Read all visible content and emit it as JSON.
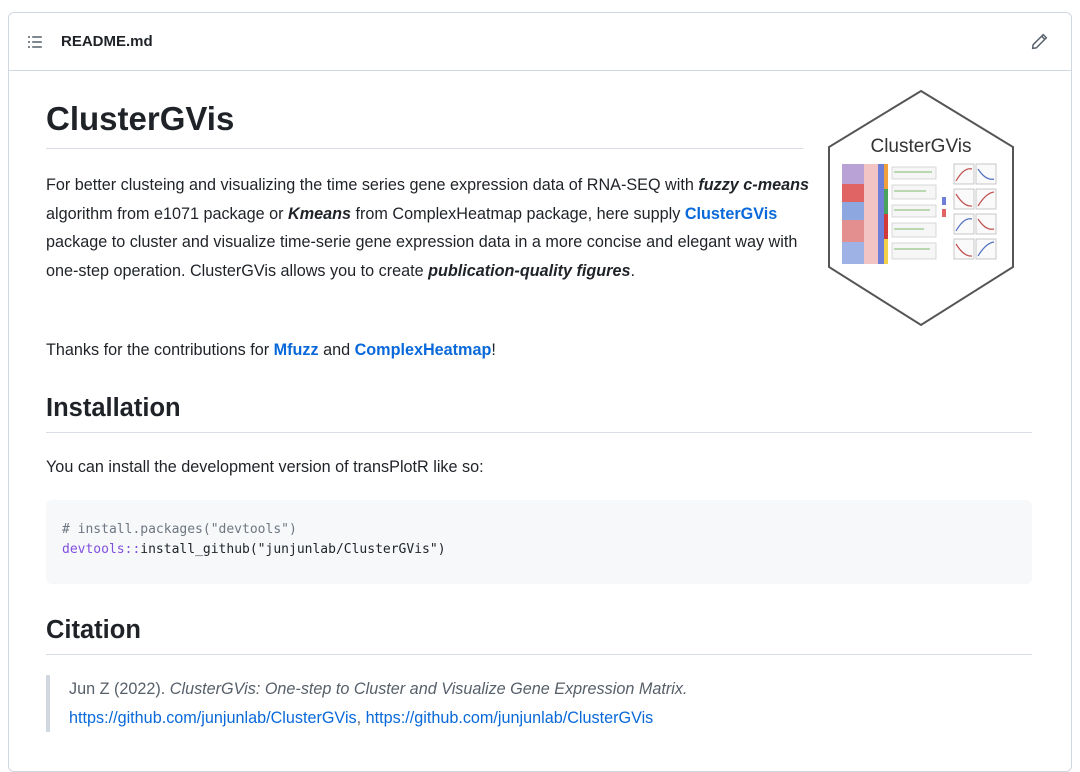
{
  "header": {
    "file_name": "README.md",
    "list_icon": "list-unordered-icon",
    "edit_icon": "pencil-icon"
  },
  "title": "ClusterGVis",
  "logo": {
    "text": "ClusterGVis"
  },
  "intro": {
    "t1": "For better clusteing and visualizing the time series gene expression data of RNA-SEQ with ",
    "e1": "fuzzy c-means",
    "t2": " algorithm from e1071 package or ",
    "e2": "Kmeans",
    "t3": " from ComplexHeatmap package, here supply ",
    "link": "ClusterGVis",
    "t4": " package to cluster and visualize time-serie gene expression data in a more concise and elegant way with one-step operation. ClusterGVis allows you to create ",
    "e3": "publication-quality figures",
    "t5": "."
  },
  "thanks": {
    "t1": "Thanks for the contributions for ",
    "link1": "Mfuzz",
    "t2": " and ",
    "link2": "ComplexHeatmap",
    "t3": "!"
  },
  "installation": {
    "heading": "Installation",
    "text": "You can install the development version of transPlotR like so:",
    "code_line1": "# install.packages(\"devtools\")",
    "code_pkg": "devtools",
    "code_op": "::",
    "code_call": "install_github(\"junjunlab/ClusterGVis\")"
  },
  "citation": {
    "heading": "Citation",
    "author": "Jun Z (2022). ",
    "work": "ClusterGVis: One-step to Cluster and Visualize Gene Expression Matrix.",
    "url1": "https://github.com/junjunlab/ClusterGVis",
    "sep": ", ",
    "url2": "https://github.com/junjunlab/ClusterGVis"
  },
  "colors": {
    "link": "#0969da",
    "border": "#d0d7de",
    "code_bg": "#f6f8fa",
    "code_keyword": "#8250df"
  }
}
